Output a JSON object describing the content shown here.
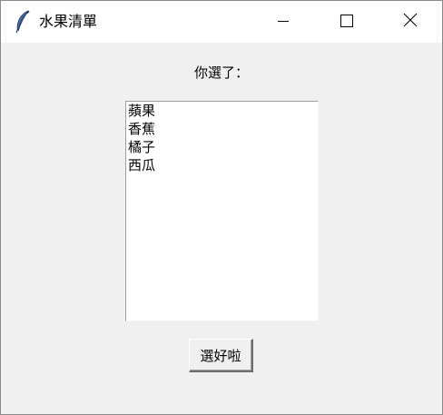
{
  "window": {
    "title": "水果清單",
    "icon": "feather-icon",
    "controls": [
      "minimize-icon",
      "maximize-icon",
      "close-icon"
    ]
  },
  "prompt": {
    "label": "你選了："
  },
  "fruit_list": {
    "items": [
      {
        "label": "蘋果"
      },
      {
        "label": "香蕉"
      },
      {
        "label": "橘子"
      },
      {
        "label": "西瓜"
      }
    ]
  },
  "actions": {
    "done_label": "選好啦"
  },
  "colors": {
    "window_bg": "#f0f0f0",
    "titlebar_bg": "#ffffff",
    "listbox_bg": "#ffffff",
    "text": "#000000"
  }
}
